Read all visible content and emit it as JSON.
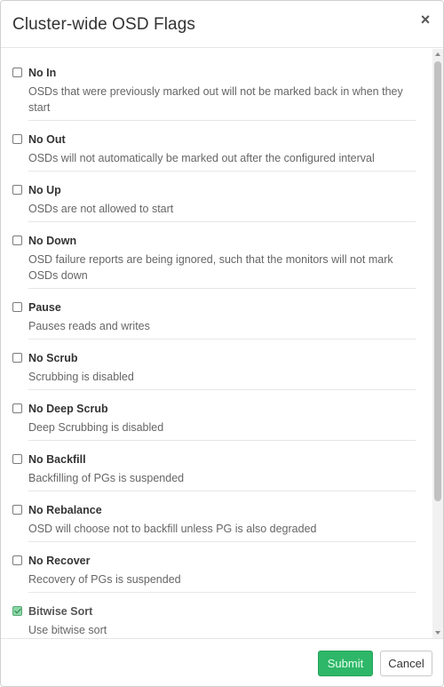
{
  "dialog": {
    "title": "Cluster-wide OSD Flags",
    "close_label": "×"
  },
  "flags": [
    {
      "label": "No In",
      "description": "OSDs that were previously marked out will not be marked back in when they start",
      "checked": false
    },
    {
      "label": "No Out",
      "description": "OSDs will not automatically be marked out after the configured interval",
      "checked": false
    },
    {
      "label": "No Up",
      "description": "OSDs are not allowed to start",
      "checked": false
    },
    {
      "label": "No Down",
      "description": "OSD failure reports are being ignored, such that the monitors will not mark OSDs down",
      "checked": false
    },
    {
      "label": "Pause",
      "description": "Pauses reads and writes",
      "checked": false
    },
    {
      "label": "No Scrub",
      "description": "Scrubbing is disabled",
      "checked": false
    },
    {
      "label": "No Deep Scrub",
      "description": "Deep Scrubbing is disabled",
      "checked": false
    },
    {
      "label": "No Backfill",
      "description": "Backfilling of PGs is suspended",
      "checked": false
    },
    {
      "label": "No Rebalance",
      "description": "OSD will choose not to backfill unless PG is also degraded",
      "checked": false
    },
    {
      "label": "No Recover",
      "description": "Recovery of PGs is suspended",
      "checked": false
    },
    {
      "label": "Bitwise Sort",
      "description": "Use bitwise sort",
      "checked": true
    }
  ],
  "footer": {
    "submit_label": "Submit",
    "cancel_label": "Cancel"
  },
  "colors": {
    "submit_green": "#2eb768",
    "checked_green": "#8bd8a6"
  }
}
